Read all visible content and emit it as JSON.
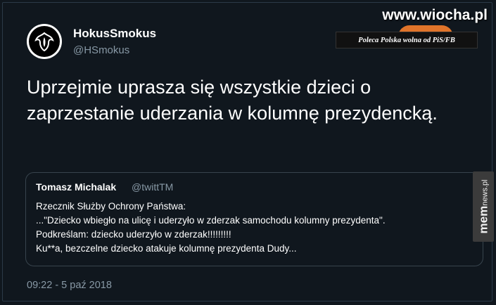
{
  "watermark": {
    "site": "www.wiocha.pl",
    "banner": "Poleca  Polska wolna od PiS/FB",
    "side_main": "mem",
    "side_sub": "news.pl"
  },
  "tweet": {
    "display_name": "HokusSmokus",
    "handle": "@HSmokus",
    "text": "Uprzejmie uprasza się wszystkie dzieci o zaprzestanie uderzania w kolumnę prezydencką.",
    "timestamp": "09:22 - 5 paź 2018"
  },
  "quoted_tweet": {
    "name": "Tomasz Michalak",
    "handle": "@twittTM",
    "lines": [
      "Rzecznik Służby Ochrony Państwa:",
      "...\"Dziecko wbiegło na ulicę i uderzyło w zderzak samochodu kolumny prezydenta\".",
      "Podkreślam: dziecko uderzyło w zderzak!!!!!!!!!",
      "Ku**a, bezczelne dziecko atakuje kolumnę prezydenta Dudy..."
    ]
  },
  "colors": {
    "background": "#10171e",
    "secondary_text": "#8899a6",
    "banner_accent": "#e0742a"
  }
}
